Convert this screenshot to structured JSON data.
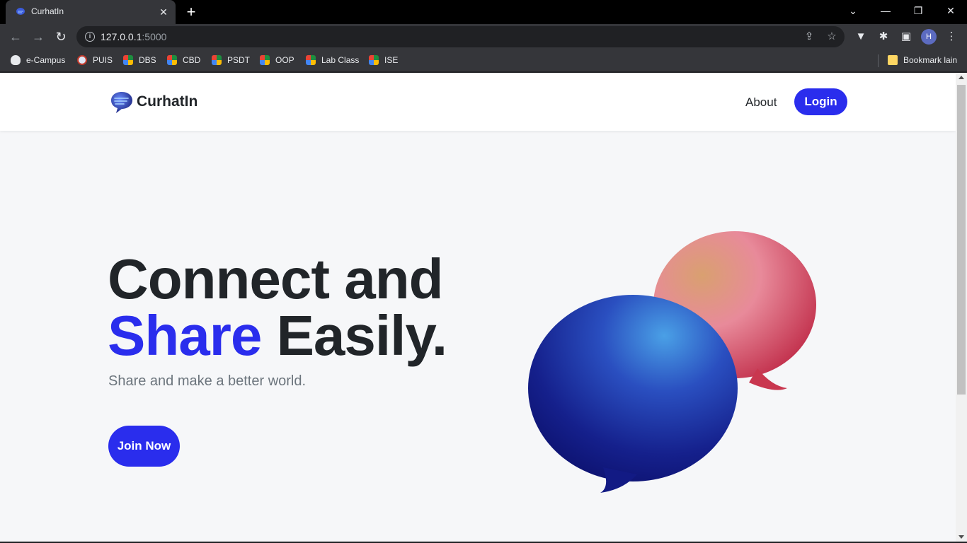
{
  "browser": {
    "tab_title": "CurhatIn",
    "url_host": "127.0.0.1",
    "url_port": ":5000",
    "profile_initial": "H",
    "bookmarks": [
      {
        "label": "e-Campus",
        "icon": "campus-icon"
      },
      {
        "label": "PUIS",
        "icon": "puis-icon"
      },
      {
        "label": "DBS",
        "icon": "meet-icon"
      },
      {
        "label": "CBD",
        "icon": "meet-icon"
      },
      {
        "label": "PSDT",
        "icon": "meet-icon"
      },
      {
        "label": "OOP",
        "icon": "meet-icon"
      },
      {
        "label": "Lab Class",
        "icon": "meet-icon"
      },
      {
        "label": "ISE",
        "icon": "meet-icon"
      }
    ],
    "other_bookmarks": "Bookmark lain"
  },
  "site": {
    "brand": "CurhatIn",
    "nav": {
      "about": "About",
      "login": "Login"
    },
    "hero": {
      "line1": "Connect and",
      "accent": "Share",
      "line2_rest": " Easily.",
      "subtitle": "Share and make a better world.",
      "cta": "Join Now"
    }
  },
  "colors": {
    "primary": "#2a2ded",
    "text": "#212529",
    "muted": "#6c757d",
    "background": "#f6f7f9"
  }
}
